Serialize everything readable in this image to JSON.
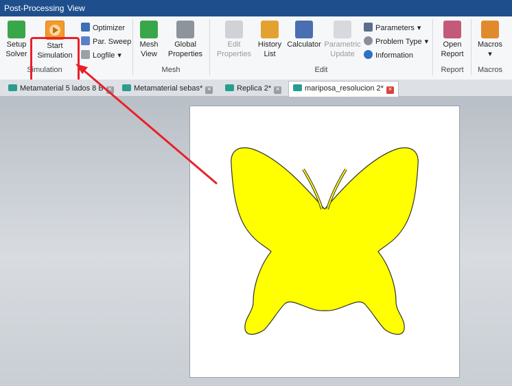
{
  "menu": {
    "items": [
      "Post-Processing",
      "View"
    ]
  },
  "ribbon": {
    "simulation": {
      "group_label": "Simulation",
      "setup_solver": "Setup\nSolver",
      "start_simulation": "Start\nSimulation",
      "optimizer": "Optimizer",
      "par_sweep": "Par. Sweep",
      "logfile": "Logfile"
    },
    "mesh": {
      "group_label": "Mesh",
      "mesh_view": "Mesh\nView",
      "global_properties": "Global\nProperties"
    },
    "edit": {
      "group_label": "Edit",
      "edit_properties": "Edit\nProperties",
      "history_list": "History\nList",
      "calculator": "Calculator",
      "parametric_update": "Parametric\nUpdate",
      "parameters": "Parameters",
      "problem_type": "Problem Type",
      "information": "Information"
    },
    "report": {
      "group_label": "Report",
      "open_report": "Open\nReport"
    },
    "macros": {
      "group_label": "Macros",
      "macros_button": "Macros"
    }
  },
  "tabs": [
    {
      "label": "Metamaterial 5 lados 8 B",
      "active": false
    },
    {
      "label": "Metamaterial sebas*",
      "active": false
    },
    {
      "label": "Replica 2*",
      "active": false
    },
    {
      "label": "mariposa_resolucion 2*",
      "active": true
    }
  ],
  "colors": {
    "menubar": "#1e4f8c",
    "shape_fill": "#ffff00",
    "highlight": "#e8202a"
  }
}
